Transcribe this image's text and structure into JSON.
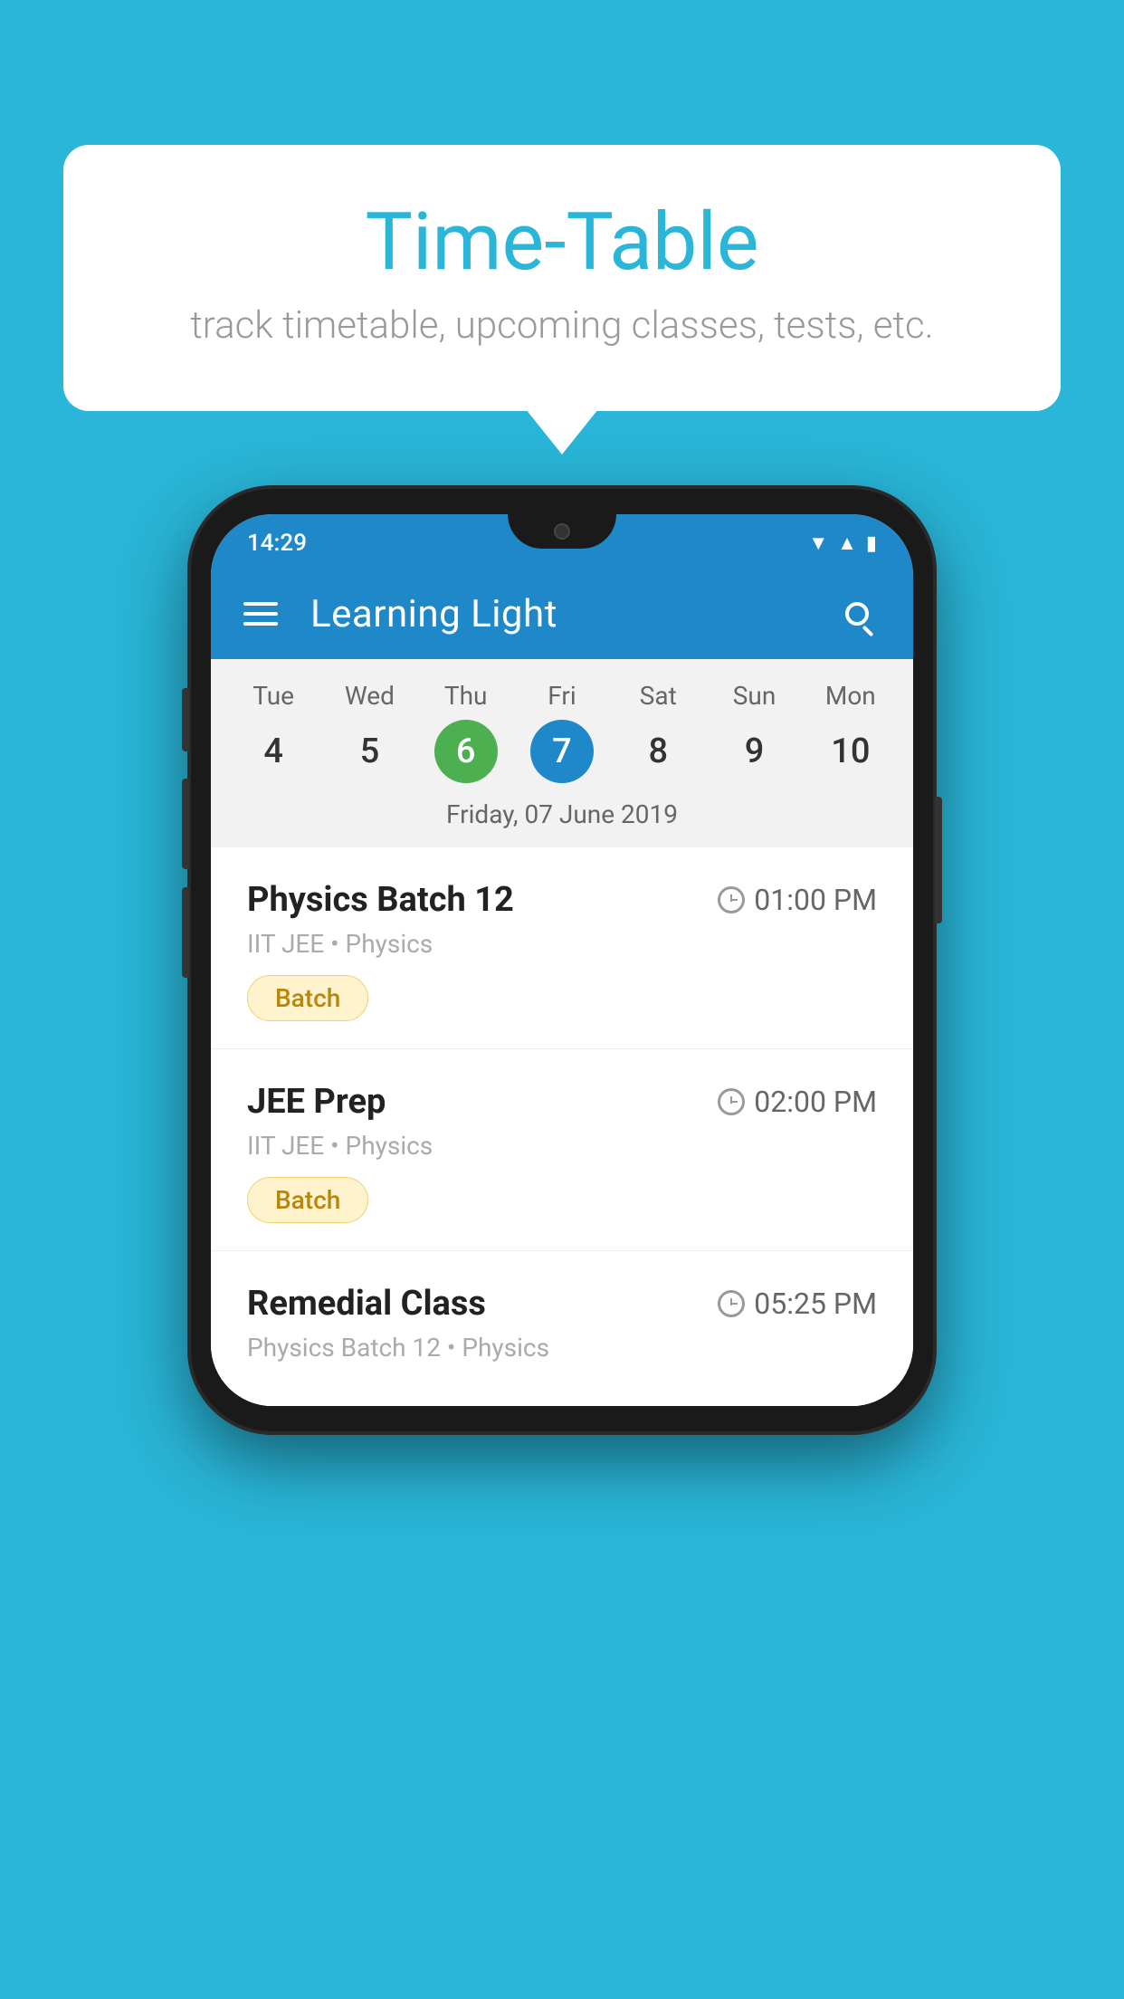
{
  "background": {
    "color": "#29b6d8"
  },
  "tooltip": {
    "title": "Time-Table",
    "subtitle": "track timetable, upcoming classes, tests, etc."
  },
  "phone": {
    "status_bar": {
      "time": "14:29",
      "wifi": "▼",
      "signal": "▲",
      "battery": "▮"
    },
    "app_bar": {
      "title": "Learning Light",
      "menu_icon": "hamburger",
      "search_icon": "search"
    },
    "calendar": {
      "days": [
        {
          "label": "Tue",
          "number": "4",
          "state": "normal"
        },
        {
          "label": "Wed",
          "number": "5",
          "state": "normal"
        },
        {
          "label": "Thu",
          "number": "6",
          "state": "today"
        },
        {
          "label": "Fri",
          "number": "7",
          "state": "selected"
        },
        {
          "label": "Sat",
          "number": "8",
          "state": "normal"
        },
        {
          "label": "Sun",
          "number": "9",
          "state": "normal"
        },
        {
          "label": "Mon",
          "number": "10",
          "state": "normal"
        }
      ],
      "selected_date_label": "Friday, 07 June 2019"
    },
    "schedule": [
      {
        "name": "Physics Batch 12",
        "time": "01:00 PM",
        "meta": "IIT JEE • Physics",
        "badge": "Batch"
      },
      {
        "name": "JEE Prep",
        "time": "02:00 PM",
        "meta": "IIT JEE • Physics",
        "badge": "Batch"
      },
      {
        "name": "Remedial Class",
        "time": "05:25 PM",
        "meta": "Physics Batch 12 • Physics",
        "badge": null
      }
    ]
  }
}
